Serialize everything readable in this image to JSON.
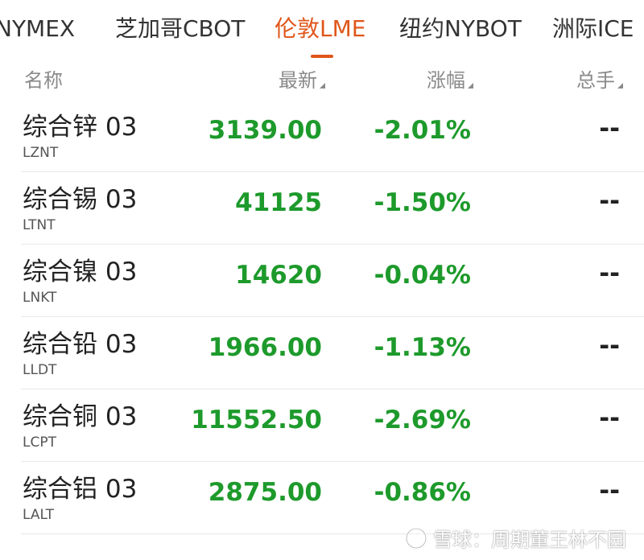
{
  "tabs": [
    {
      "label": "NYMEX",
      "active": false
    },
    {
      "label": "芝加哥CBOT",
      "active": false
    },
    {
      "label": "伦敦LME",
      "active": true
    },
    {
      "label": "纽约NYBOT",
      "active": false
    },
    {
      "label": "洲际ICE",
      "active": false
    }
  ],
  "columns": {
    "name": "名称",
    "latest": "最新",
    "change": "涨幅",
    "volume": "总手"
  },
  "rows": [
    {
      "name": "综合锌 03",
      "code": "LZNT",
      "price": "3139.00",
      "change": "-2.01%",
      "volume": "--"
    },
    {
      "name": "综合锡 03",
      "code": "LTNT",
      "price": "41125",
      "change": "-1.50%",
      "volume": "--"
    },
    {
      "name": "综合镍 03",
      "code": "LNKT",
      "price": "14620",
      "change": "-0.04%",
      "volume": "--"
    },
    {
      "name": "综合铅 03",
      "code": "LLDT",
      "price": "1966.00",
      "change": "-1.13%",
      "volume": "--"
    },
    {
      "name": "综合铜 03",
      "code": "LCPT",
      "price": "11552.50",
      "change": "-2.69%",
      "volume": "--"
    },
    {
      "name": "综合铝 03",
      "code": "LALT",
      "price": "2875.00",
      "change": "-0.86%",
      "volume": "--"
    }
  ],
  "colors": {
    "accent": "#e0561a",
    "down": "#1d9a2b",
    "text": "#222222",
    "muted": "#8a8a8a"
  },
  "watermark": "雪球：周期董王林不园"
}
